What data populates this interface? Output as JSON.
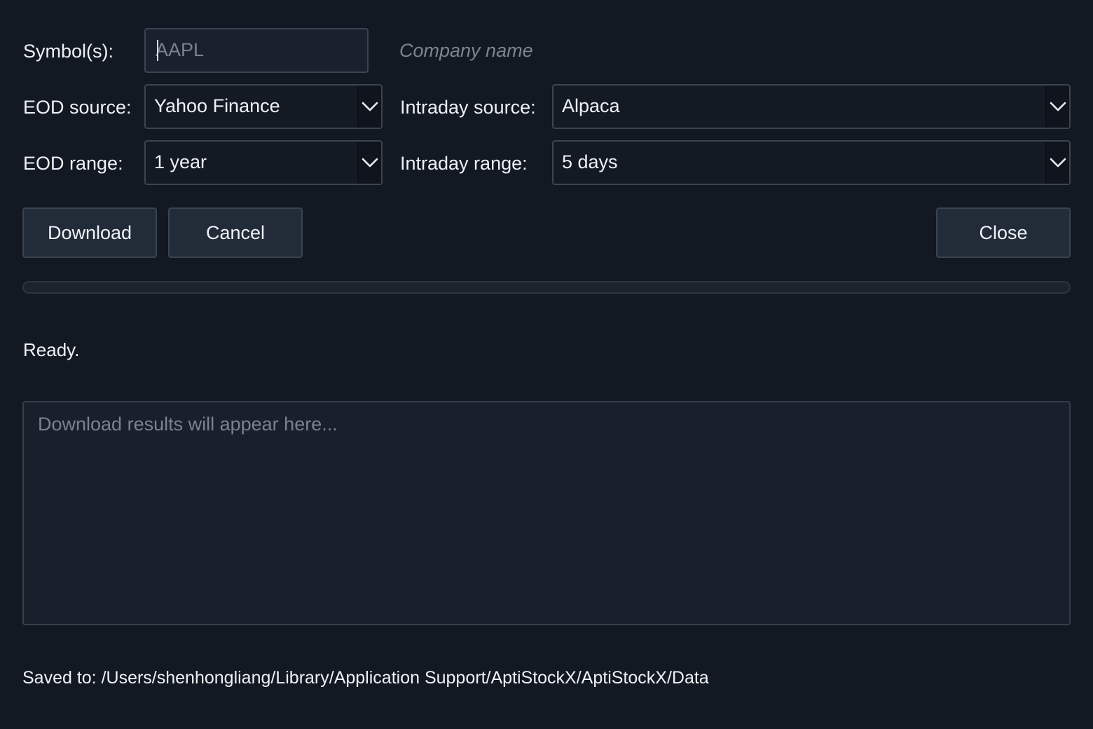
{
  "form": {
    "symbol_label": "Symbol(s):",
    "symbol_value": "",
    "symbol_placeholder": "AAPL",
    "company_name": "Company name",
    "eod_source_label": "EOD source:",
    "eod_source_value": "Yahoo Finance",
    "intraday_source_label": "Intraday source:",
    "intraday_source_value": "Alpaca",
    "eod_range_label": "EOD range:",
    "eod_range_value": "1 year",
    "intraday_range_label": "Intraday range:",
    "intraday_range_value": "5 days"
  },
  "buttons": {
    "download": "Download",
    "cancel": "Cancel",
    "close": "Close"
  },
  "progress": {
    "fraction": 0
  },
  "status": {
    "text": "Ready."
  },
  "results": {
    "value": "",
    "placeholder": "Download results will appear here..."
  },
  "footer": {
    "saved_to": "Saved to: /Users/shenhongliang/Library/Application Support/AptiStockX/AptiStockX/Data"
  },
  "icons": {
    "dropdown": "chevron-down-icon"
  },
  "colors": {
    "background": "#131922",
    "button": "#222b38",
    "border": "#3b4452",
    "text": "#eef1f5",
    "placeholder": "#7b828d"
  }
}
